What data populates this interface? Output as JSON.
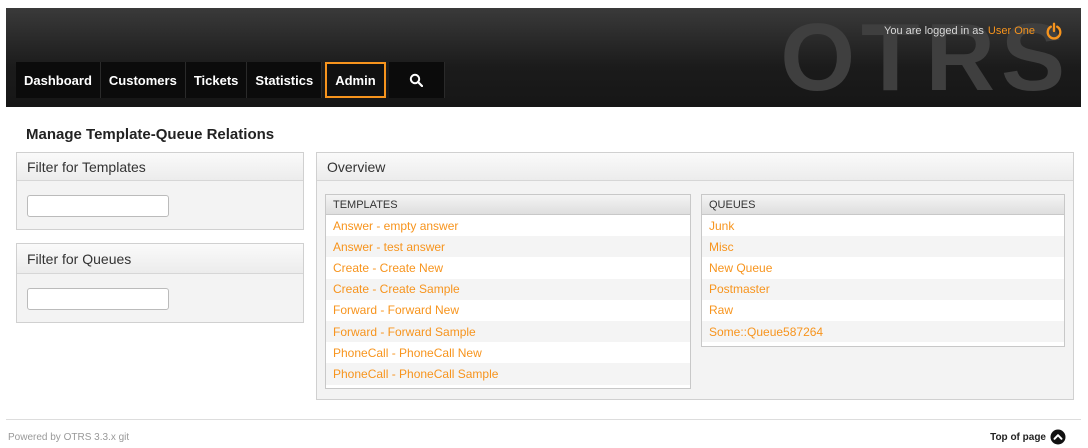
{
  "header": {
    "logo_text": "OTRS",
    "login_prefix": "You are logged in as",
    "user_name": "User One",
    "nav": [
      {
        "label": "Dashboard"
      },
      {
        "label": "Customers"
      },
      {
        "label": "Tickets"
      },
      {
        "label": "Statistics"
      },
      {
        "label": "Admin",
        "active": true
      }
    ],
    "search_icon": "search-icon",
    "logout_icon": "power-icon"
  },
  "page": {
    "title": "Manage Template-Queue Relations"
  },
  "sidebar": {
    "templates_filter": {
      "title": "Filter for Templates",
      "value": ""
    },
    "queues_filter": {
      "title": "Filter for Queues",
      "value": ""
    }
  },
  "overview": {
    "title": "Overview",
    "templates": {
      "header": "TEMPLATES",
      "items": [
        "Answer - empty answer",
        "Answer - test answer",
        "Create - Create New",
        "Create - Create Sample",
        "Forward - Forward New",
        "Forward - Forward Sample",
        "PhoneCall - PhoneCall New",
        "PhoneCall - PhoneCall Sample"
      ]
    },
    "queues": {
      "header": "QUEUES",
      "items": [
        "Junk",
        "Misc",
        "New Queue",
        "Postmaster",
        "Raw",
        "Some::Queue587264"
      ]
    }
  },
  "footer": {
    "powered_by": "Powered by OTRS 3.3.x git",
    "top_of_page": "Top of page"
  },
  "colors": {
    "accent": "#f7941d",
    "header_bg": "#1b1b1b"
  }
}
